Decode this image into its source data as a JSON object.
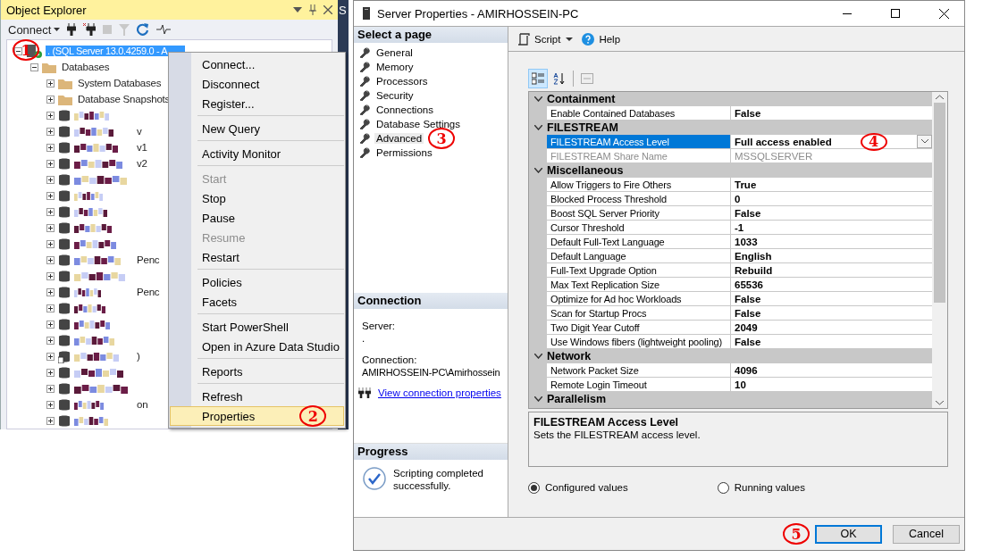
{
  "object_explorer": {
    "title": "Object Explorer",
    "connect_label": "Connect",
    "server": {
      "label": ". (SQL Server 13.0.4259.0 - A",
      "selected": true,
      "expanded": true,
      "marker": "1"
    },
    "databases": {
      "label": "Databases",
      "expanded": true,
      "items": [
        {
          "kind": "folder",
          "label": "System Databases"
        },
        {
          "kind": "folder",
          "label": "Database Snapshots"
        },
        {
          "kind": "database"
        },
        {
          "kind": "database",
          "tail": "v"
        },
        {
          "kind": "database",
          "tail": "v1"
        },
        {
          "kind": "database",
          "tail": "v2"
        },
        {
          "kind": "database"
        },
        {
          "kind": "database"
        },
        {
          "kind": "database"
        },
        {
          "kind": "database"
        },
        {
          "kind": "database"
        },
        {
          "kind": "database",
          "tail": "Penc"
        },
        {
          "kind": "database"
        },
        {
          "kind": "database",
          "tail": "Penc"
        },
        {
          "kind": "database"
        },
        {
          "kind": "database"
        },
        {
          "kind": "database"
        },
        {
          "kind": "replica",
          "tail": ")"
        },
        {
          "kind": "database"
        },
        {
          "kind": "database"
        },
        {
          "kind": "database",
          "tail": "on"
        },
        {
          "kind": "database"
        }
      ]
    }
  },
  "side_tab": {
    "label": "S"
  },
  "context_menu": {
    "groups": [
      [
        {
          "label": "Connect...",
          "disabled": false,
          "selected": false
        },
        {
          "label": "Disconnect",
          "disabled": false,
          "selected": false
        },
        {
          "label": "Register...",
          "disabled": false,
          "selected": false
        }
      ],
      [
        {
          "label": "New Query",
          "disabled": false,
          "selected": false
        }
      ],
      [
        {
          "label": "Activity Monitor",
          "disabled": false,
          "selected": false
        }
      ],
      [
        {
          "label": "Start",
          "disabled": true,
          "selected": false
        },
        {
          "label": "Stop",
          "disabled": false,
          "selected": false
        },
        {
          "label": "Pause",
          "disabled": false,
          "selected": false
        },
        {
          "label": "Resume",
          "disabled": true,
          "selected": false
        },
        {
          "label": "Restart",
          "disabled": false,
          "selected": false
        }
      ],
      [
        {
          "label": "Policies",
          "disabled": false,
          "selected": false
        },
        {
          "label": "Facets",
          "disabled": false,
          "selected": false
        }
      ],
      [
        {
          "label": "Start PowerShell",
          "disabled": false,
          "selected": false
        },
        {
          "label": "Open in Azure Data Studio",
          "disabled": false,
          "selected": false
        }
      ],
      [
        {
          "label": "Reports",
          "disabled": false,
          "selected": false
        }
      ],
      [
        {
          "label": "Refresh",
          "disabled": false,
          "selected": false
        },
        {
          "label": "Properties",
          "disabled": false,
          "selected": true,
          "marker": "2"
        }
      ]
    ]
  },
  "dialog": {
    "title": "Server Properties - AMIRHOSSEIN-PC",
    "select_page": {
      "header": "Select a page",
      "pages": [
        {
          "label": "General",
          "selected": false
        },
        {
          "label": "Memory",
          "selected": false
        },
        {
          "label": "Processors",
          "selected": false
        },
        {
          "label": "Security",
          "selected": false
        },
        {
          "label": "Connections",
          "selected": false
        },
        {
          "label": "Database Settings",
          "selected": false
        },
        {
          "label": "Advanced",
          "selected": true,
          "marker": "3"
        },
        {
          "label": "Permissions",
          "selected": false
        }
      ]
    },
    "connection": {
      "header": "Connection",
      "server_label": "Server:",
      "server_value": ".",
      "connection_label": "Connection:",
      "connection_value": "AMIRHOSSEIN-PC\\Amirhossein",
      "link": "View connection properties"
    },
    "progress": {
      "header": "Progress",
      "message": "Scripting completed successfully."
    },
    "toolbar": {
      "script": "Script",
      "help": "Help"
    },
    "grid": {
      "categories": [
        {
          "name": "Containment",
          "expanded": true,
          "properties": [
            {
              "name": "Enable Contained Databases",
              "value": "False",
              "selected": false,
              "disabled": false
            }
          ]
        },
        {
          "name": "FILESTREAM",
          "expanded": true,
          "properties": [
            {
              "name": "FILESTREAM Access Level",
              "value": "Full access enabled",
              "selected": true,
              "disabled": false,
              "marker": "4"
            },
            {
              "name": "FILESTREAM Share Name",
              "value": "MSSQLSERVER",
              "selected": false,
              "disabled": true
            }
          ]
        },
        {
          "name": "Miscellaneous",
          "expanded": true,
          "properties": [
            {
              "name": "Allow Triggers to Fire Others",
              "value": "True",
              "selected": false,
              "disabled": false
            },
            {
              "name": "Blocked Process Threshold",
              "value": "0",
              "selected": false,
              "disabled": false
            },
            {
              "name": "Boost SQL Server Priority",
              "value": "False",
              "selected": false,
              "disabled": false
            },
            {
              "name": "Cursor Threshold",
              "value": "-1",
              "selected": false,
              "disabled": false
            },
            {
              "name": "Default Full-Text Language",
              "value": "1033",
              "selected": false,
              "disabled": false
            },
            {
              "name": "Default Language",
              "value": "English",
              "selected": false,
              "disabled": false
            },
            {
              "name": "Full-Text Upgrade Option",
              "value": "Rebuild",
              "selected": false,
              "disabled": false
            },
            {
              "name": "Max Text Replication Size",
              "value": "65536",
              "selected": false,
              "disabled": false
            },
            {
              "name": "Optimize for Ad hoc Workloads",
              "value": "False",
              "selected": false,
              "disabled": false
            },
            {
              "name": "Scan for Startup Procs",
              "value": "False",
              "selected": false,
              "disabled": false
            },
            {
              "name": "Two Digit Year Cutoff",
              "value": "2049",
              "selected": false,
              "disabled": false
            },
            {
              "name": "Use Windows fibers (lightweight pooling)",
              "value": "False",
              "selected": false,
              "disabled": false
            }
          ]
        },
        {
          "name": "Network",
          "expanded": true,
          "properties": [
            {
              "name": "Network Packet Size",
              "value": "4096",
              "selected": false,
              "disabled": false
            },
            {
              "name": "Remote Login Timeout",
              "value": "10",
              "selected": false,
              "disabled": false
            }
          ]
        },
        {
          "name": "Parallelism",
          "expanded": true
        }
      ]
    },
    "description": {
      "title": "FILESTREAM Access Level",
      "text": "Sets the FILESTREAM access level."
    },
    "value_modes": [
      {
        "label": "Configured values",
        "selected": true
      },
      {
        "label": "Running values",
        "selected": false
      }
    ],
    "buttons": [
      {
        "label": "OK",
        "default": true,
        "marker": "5"
      },
      {
        "label": "Cancel",
        "default": false
      }
    ]
  }
}
